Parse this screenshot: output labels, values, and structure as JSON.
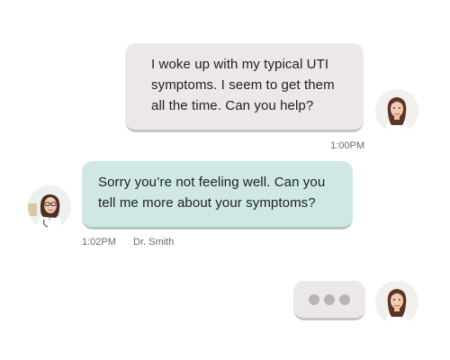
{
  "conversation": {
    "messages": [
      {
        "sender": "patient",
        "text": "I woke up with my typical UTI symptoms. I seem to get them all the time. Can you help?",
        "time": "1:00PM"
      },
      {
        "sender": "doctor",
        "sender_name": "Dr. Smith",
        "text": "Sorry you’re not feeling well. Can you tell me more about your symptoms?",
        "time": "1:02PM"
      }
    ],
    "typing_indicator": {
      "sender": "patient",
      "dots": 3
    }
  },
  "colors": {
    "patient_bubble": "#ede8e8",
    "doctor_bubble": "#cfe8e3",
    "typing_dot": "#b9b4b4",
    "meta_text": "#6a6a6a"
  },
  "icons": {
    "patient_avatar": "patient-avatar-icon",
    "doctor_avatar": "doctor-avatar-icon"
  }
}
